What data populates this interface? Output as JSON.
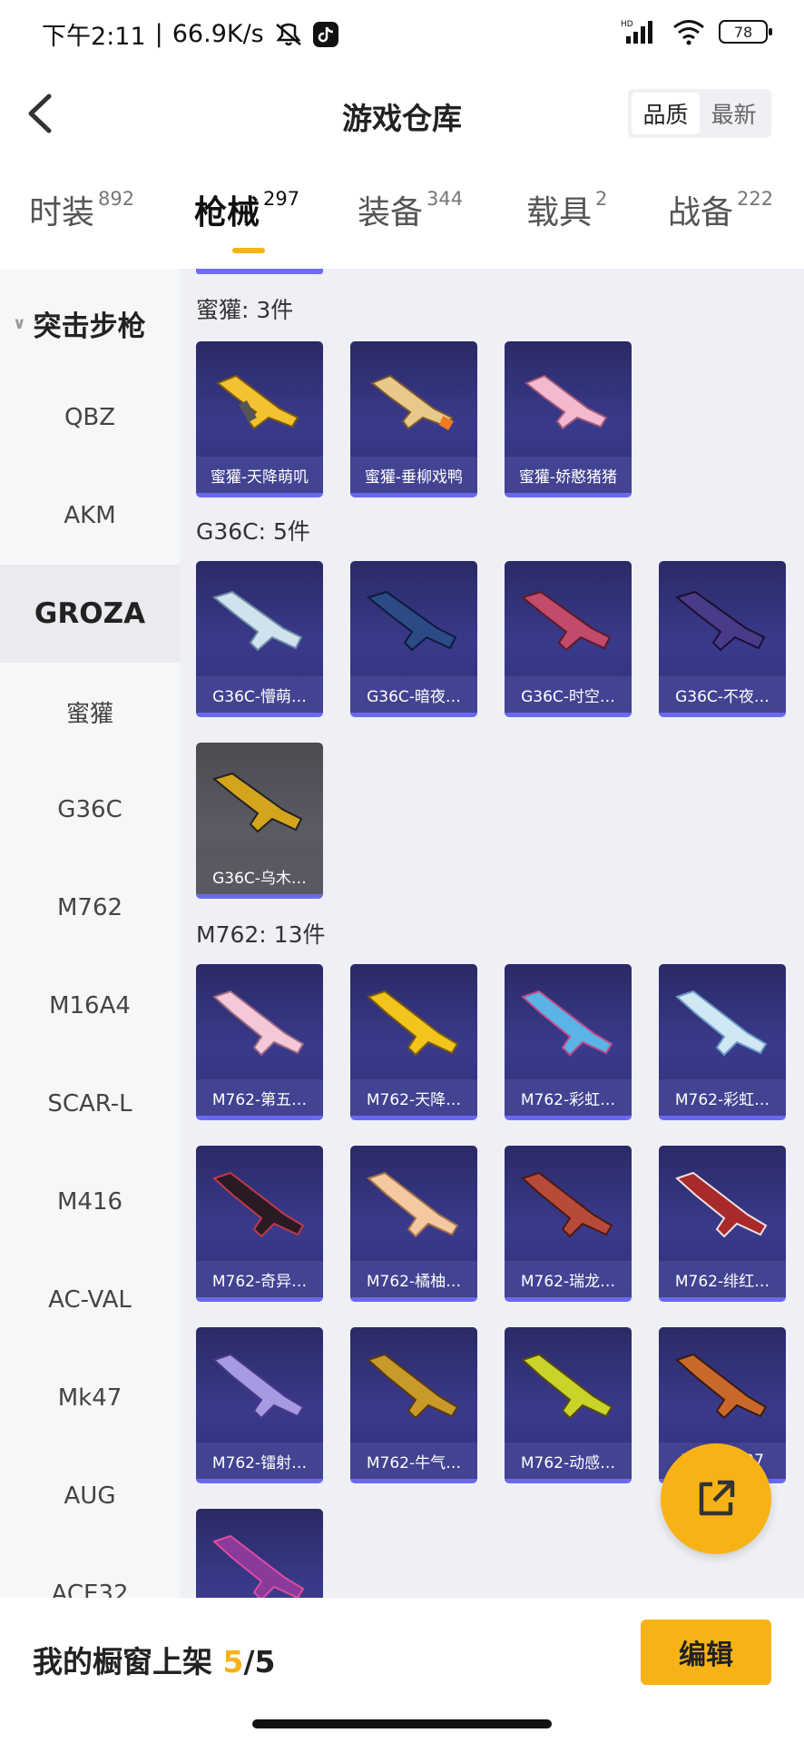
{
  "status_bar": {
    "time": "下午2:11",
    "separator": "|",
    "speed": "66.9K/s",
    "battery": "78"
  },
  "header": {
    "title": "游戏仓库",
    "sort": {
      "options": [
        "品质",
        "最新"
      ],
      "active_index": 0
    }
  },
  "tabs": [
    {
      "label": "时装",
      "count": "892"
    },
    {
      "label": "枪械",
      "count": "297",
      "active": true
    },
    {
      "label": "装备",
      "count": "344"
    },
    {
      "label": "载具",
      "count": "2"
    },
    {
      "label": "战备",
      "count": "222"
    }
  ],
  "sidebar": {
    "group": "突击步枪",
    "items": [
      "QBZ",
      "AKM",
      "GROZA",
      "蜜獾",
      "G36C",
      "M762",
      "M16A4",
      "SCAR-L",
      "M416",
      "AC-VAL",
      "Mk47",
      "AUG",
      "ACE32"
    ],
    "active_item": "GROZA"
  },
  "sections": [
    {
      "title": "蜜獾: 3件",
      "items": [
        "蜜獾-天降萌叽",
        "蜜獾-垂柳戏鸭",
        "蜜獾-娇憨猪猪"
      ]
    },
    {
      "title": "G36C: 5件",
      "items": [
        "G36C-懵萌…",
        "G36C-暗夜…",
        "G36C-时空…",
        "G36C-不夜…",
        "G36C-乌木…"
      ]
    },
    {
      "title": "M762: 13件",
      "items": [
        "M762-第五…",
        "M762-天降…",
        "M762-彩虹…",
        "M762-彩虹…",
        "M762-奇异…",
        "M762-橘柚…",
        "M762-瑞龙…",
        "M762-绯红…",
        "M762-镭射…",
        "M762-牛气…",
        "M762-动感…",
        "M762-…97",
        ""
      ]
    }
  ],
  "bottom": {
    "label": "我的橱窗上架",
    "current": "5",
    "total": "/5",
    "edit_button": "编辑"
  },
  "colors": {
    "accent": "#f5b316",
    "card_top": "#2a2a66",
    "card_border": "#6b68f0"
  }
}
